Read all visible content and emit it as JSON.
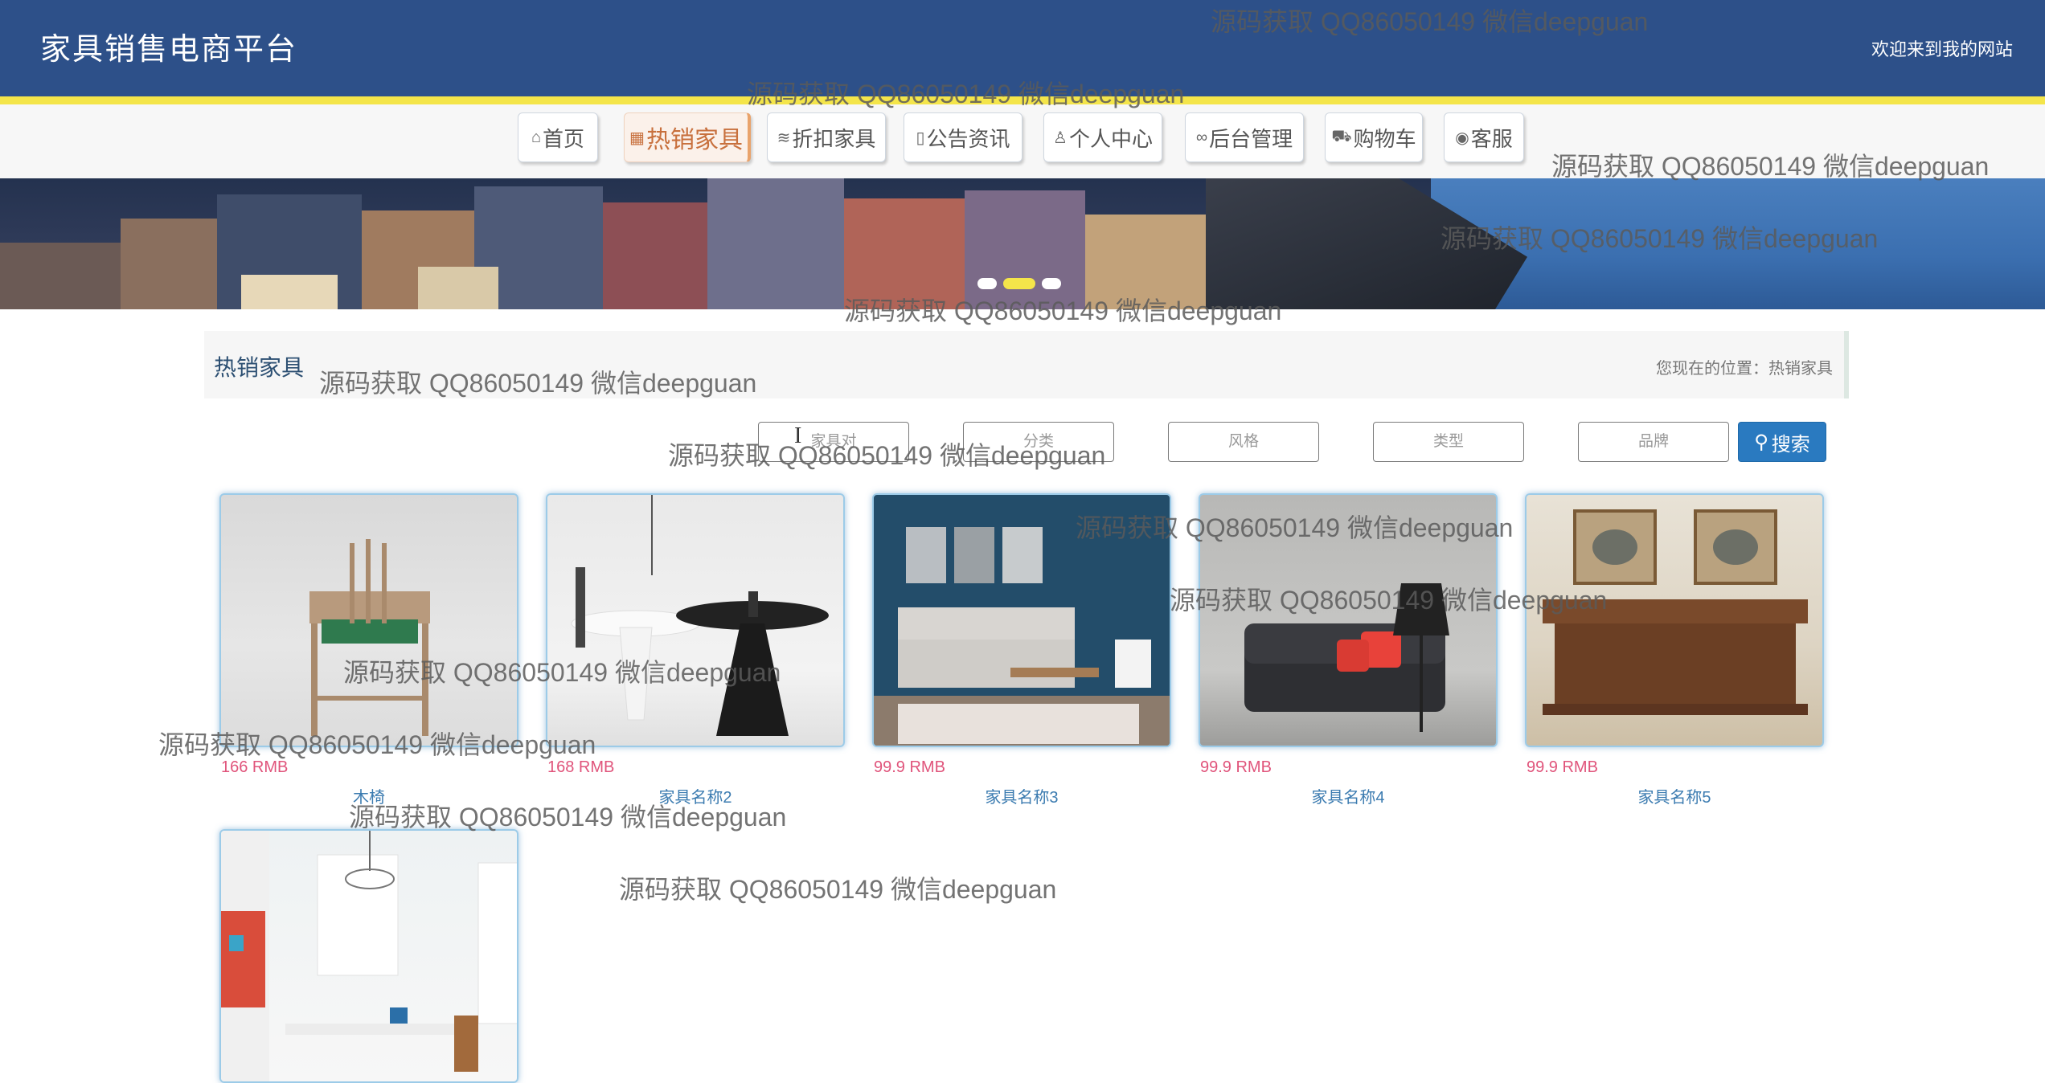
{
  "header": {
    "site_title": "家具销售电商平台",
    "welcome": "欢迎来到我的网站"
  },
  "nav": [
    {
      "label": "首页",
      "icon": "home-icon",
      "glyph": "⌂",
      "active": false
    },
    {
      "label": "热销家具",
      "icon": "calendar-icon",
      "glyph": "▦",
      "active": true
    },
    {
      "label": "折扣家具",
      "icon": "layers-icon",
      "glyph": "≋",
      "active": false
    },
    {
      "label": "公告资讯",
      "icon": "document-icon",
      "glyph": "▯",
      "active": false
    },
    {
      "label": "个人中心",
      "icon": "user-icon",
      "glyph": "♙",
      "active": false
    },
    {
      "label": "后台管理",
      "icon": "link-icon",
      "glyph": "∞",
      "active": false
    },
    {
      "label": "购物车",
      "icon": "cart-icon",
      "glyph": "⛟",
      "active": false
    },
    {
      "label": "客服",
      "icon": "chat-icon",
      "glyph": "◉",
      "active": false
    }
  ],
  "banner": {
    "active_slide": 2,
    "slide_count": 3
  },
  "section": {
    "title": "热销家具",
    "breadcrumb": "您现在的位置：热销家具"
  },
  "search": {
    "fields": [
      {
        "placeholder": "家具对",
        "value": ""
      },
      {
        "placeholder": "分类",
        "value": ""
      },
      {
        "placeholder": "风格",
        "value": ""
      },
      {
        "placeholder": "类型",
        "value": ""
      },
      {
        "placeholder": "品牌",
        "value": ""
      }
    ],
    "button_label": "搜索"
  },
  "products": [
    {
      "price": "166 RMB",
      "name": "木椅"
    },
    {
      "price": "168 RMB",
      "name": "家具名称2"
    },
    {
      "price": "99.9 RMB",
      "name": "家具名称3"
    },
    {
      "price": "99.9 RMB",
      "name": "家具名称4"
    },
    {
      "price": "99.9 RMB",
      "name": "家具名称5"
    },
    {
      "price": "",
      "name": ""
    }
  ],
  "watermarks": [
    "源码获取 QQ86050149 微信deepguan",
    "源码获取 QQ86050149 微信deepguan",
    "源码获取 QQ86050149 微信deepguan",
    "源码获取 QQ86050149 微信deepguan",
    "源码获取 QQ86050149 微信deepguan",
    "源码获取 QQ86050149 微信deepguan",
    "源码获取 QQ86050149 微信deepguan",
    "源码获取 QQ86050149 微信deepguan",
    "源码获取 QQ86050149 微信deepguan",
    "源码获取 QQ86050149 微信deepguan",
    "源码获取 QQ86050149 微信deepguan",
    "源码获取 QQ86050149 微信deepguan",
    "源码获取 QQ86050149 微信deepguan"
  ],
  "colors": {
    "header_bg": "#2d5089",
    "accent_yellow": "#f4e54a",
    "price": "#e0547b",
    "link": "#3b7bb0",
    "search_button": "#2a7ac0"
  }
}
